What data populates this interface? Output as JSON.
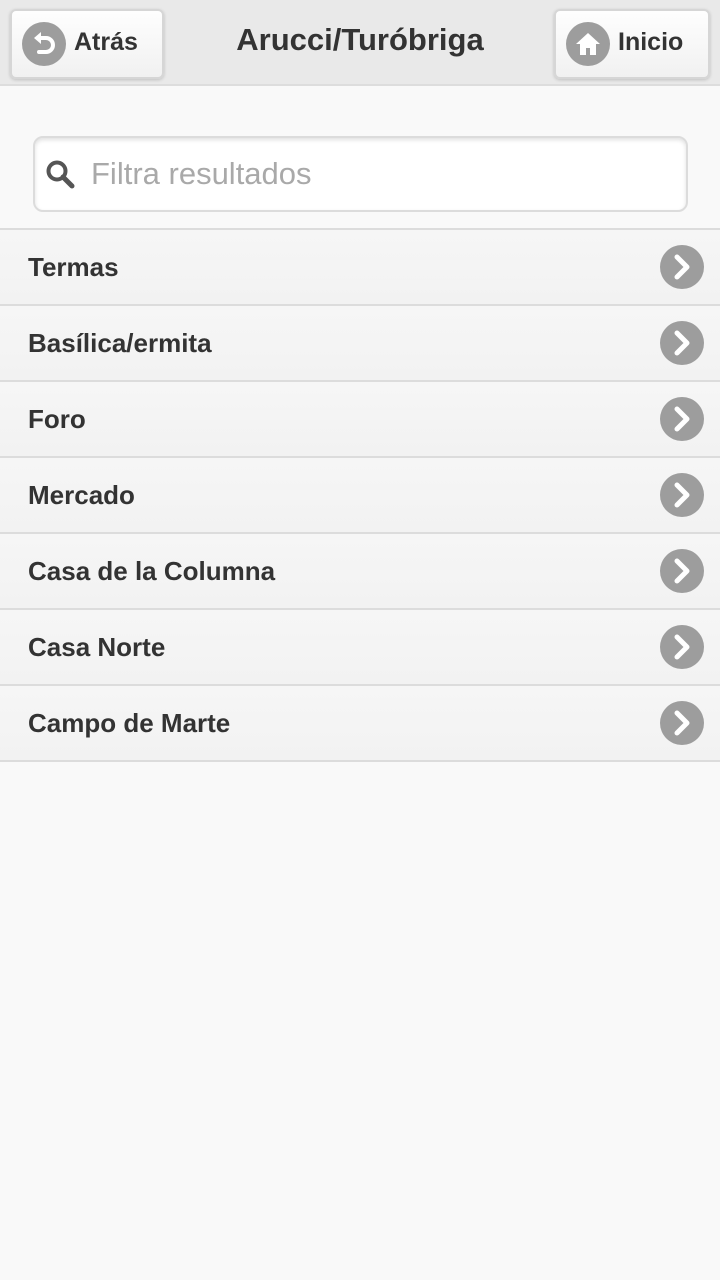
{
  "header": {
    "back_label": "Atrás",
    "title": "Arucci/Turóbriga",
    "home_label": "Inicio"
  },
  "search": {
    "placeholder": "Filtra resultados",
    "value": ""
  },
  "list": {
    "items": [
      {
        "label": "Termas"
      },
      {
        "label": "Basílica/ermita"
      },
      {
        "label": "Foro"
      },
      {
        "label": "Mercado"
      },
      {
        "label": "Casa de la Columna"
      },
      {
        "label": "Casa Norte"
      },
      {
        "label": "Campo de Marte"
      }
    ]
  },
  "icons": {
    "back": "back-arrow-icon",
    "home": "home-icon",
    "search": "search-icon",
    "item_arrow": "chevron-right-icon"
  },
  "colors": {
    "header_bg": "#e9e9e9",
    "page_bg": "#f9f9f9",
    "icon_circle": "#9d9d9d",
    "text": "#333333",
    "placeholder": "#a9a9a9"
  }
}
